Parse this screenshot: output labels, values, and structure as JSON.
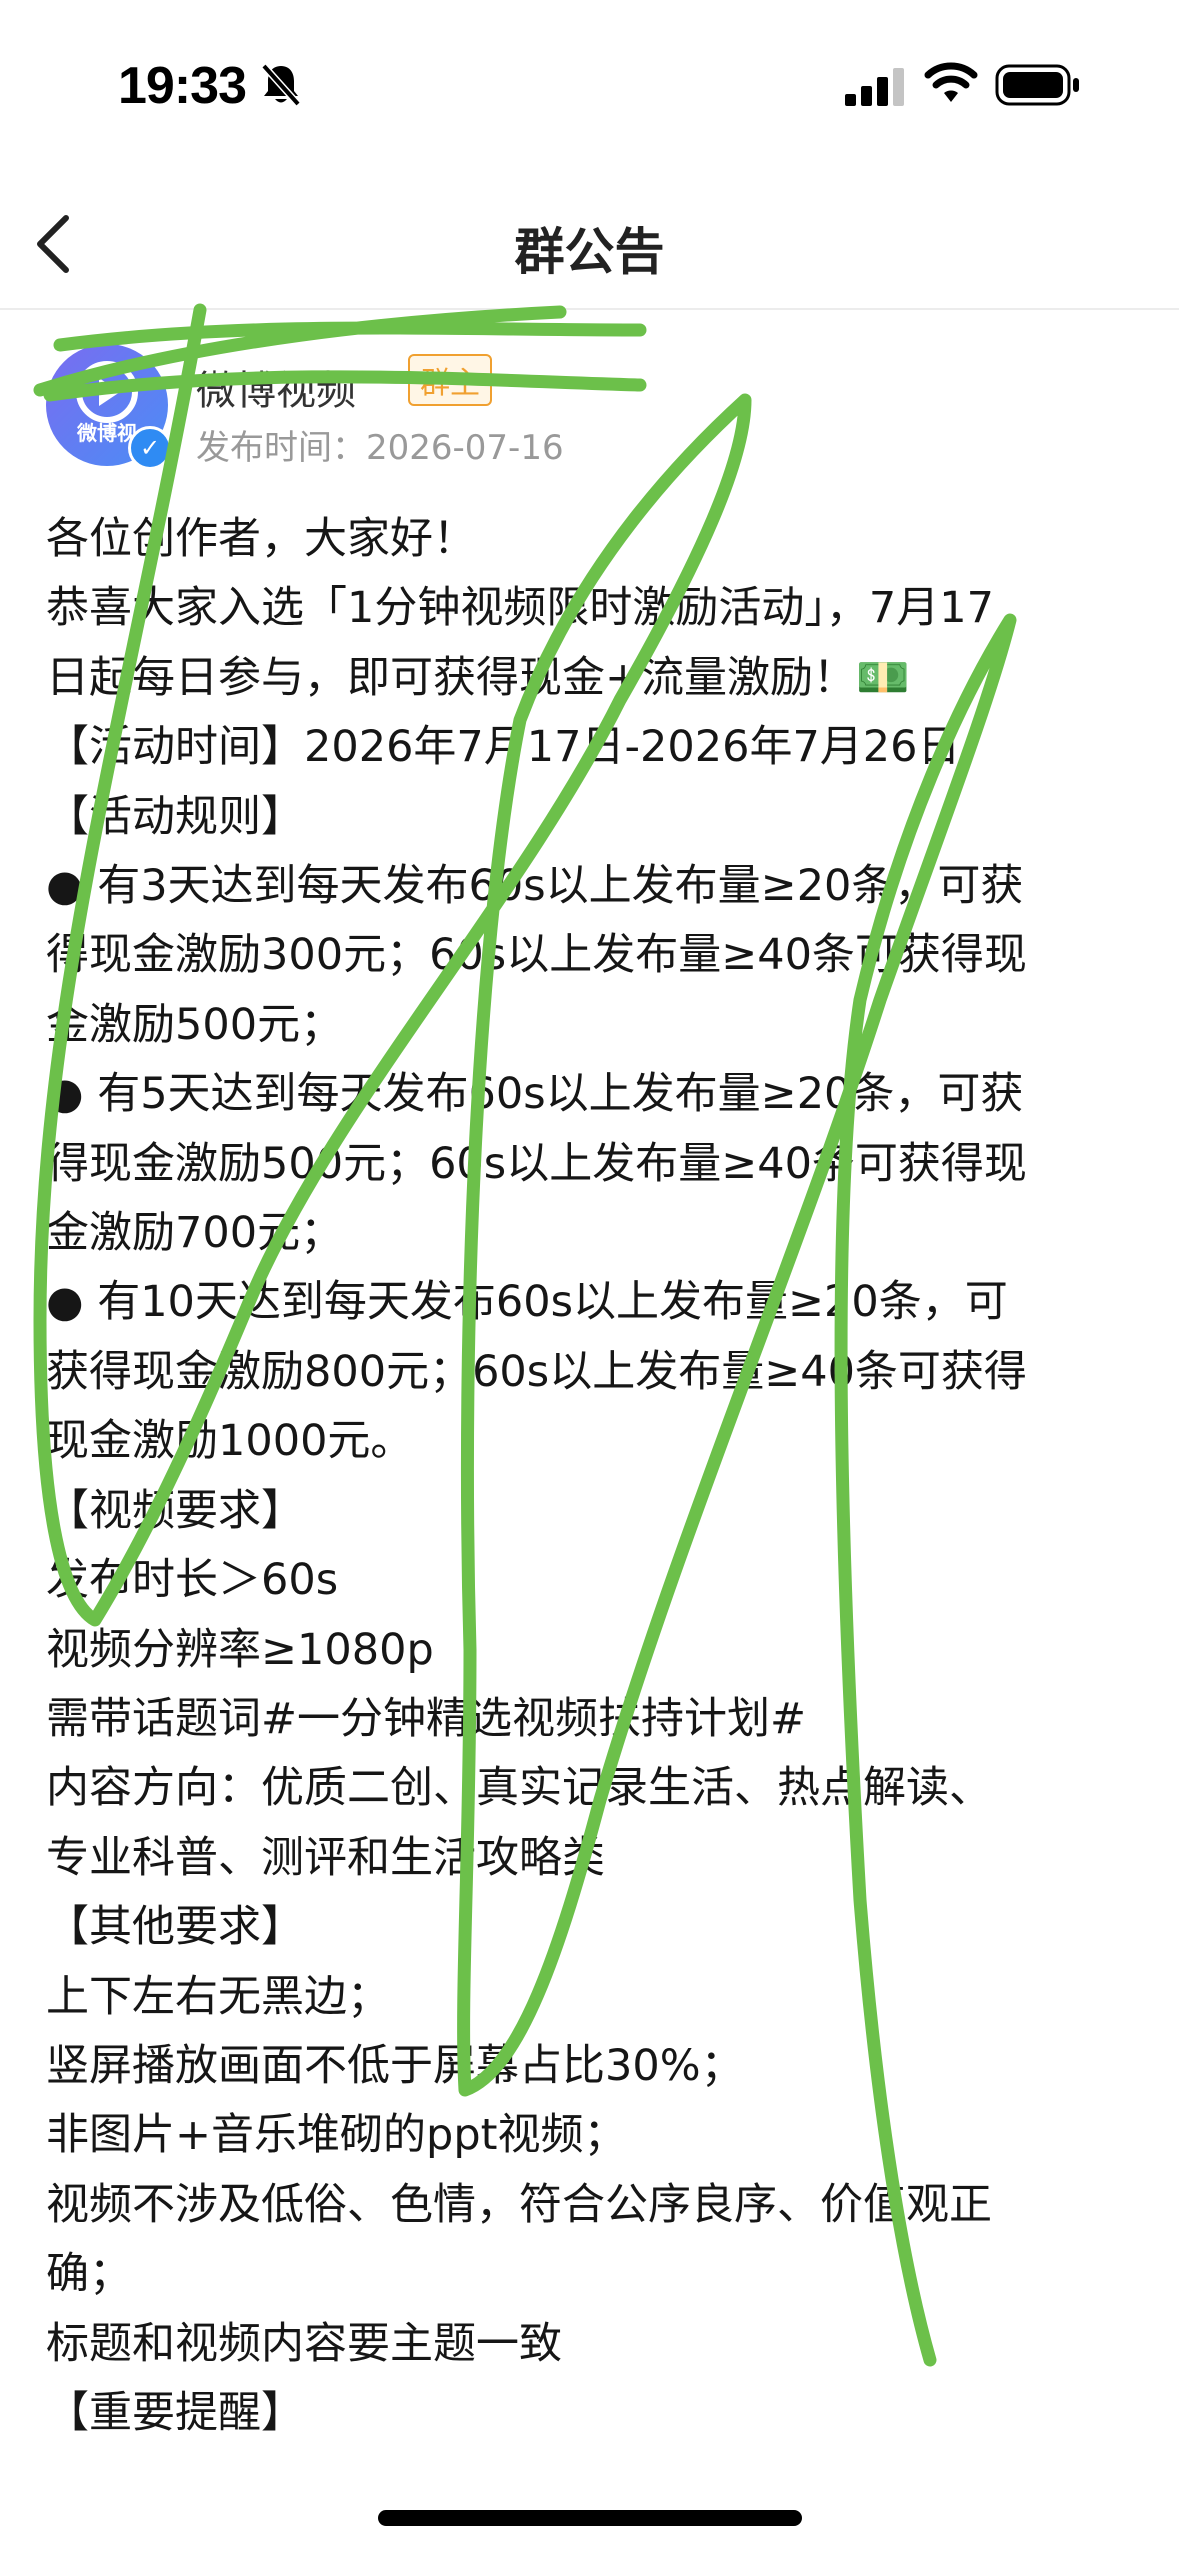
{
  "status_bar": {
    "time": "19:33",
    "icons": [
      "bell-off-icon",
      "signal-icon",
      "wifi-icon",
      "battery-icon"
    ]
  },
  "nav": {
    "back_icon": "chevron-left-icon",
    "title": "群公告"
  },
  "author": {
    "avatar_text": "微博视",
    "name": "微博视频",
    "badge": "群主",
    "publish_time": "发布时间：2026-07-16"
  },
  "announcement": {
    "lines": [
      "各位创作者，大家好！",
      "恭喜大家入选「1分钟视频限时激励活动」，7月17",
      "日起每日参与，即可获得现金+流量激励！💵",
      "【活动时间】2026年7月17日-2026年7月26日",
      "【活动规则】",
      "● 有3天达到每天发布60s以上发布量≥20条，可获",
      "得现金激励300元；60s以上发布量≥40条可获得现",
      "金激励500元；",
      "● 有5天达到每天发布60s以上发布量≥20条，可获",
      "得现金激励500元；60s以上发布量≥40条可获得现",
      "金激励700元；",
      "● 有10天达到每天发布60s以上发布量≥20条，可",
      "获得现金激励800元；60s以上发布量≥40条可获得",
      "现金激励1000元。",
      "【视频要求】",
      "发布时长＞60s",
      "视频分辨率≥1080p",
      "需带话题词#一分钟精选视频扶持计划#",
      "内容方向：优质二创、真实记录生活、热点解读、",
      "专业科普、测评和生活攻略类",
      "【其他要求】",
      "上下左右无黑边；",
      "竖屏播放画面不低于屏幕占比30%；",
      "非图片+音乐堆砌的ppt视频；",
      "视频不涉及低俗、色情，符合公序良序、价值观正",
      "确；",
      "标题和视频内容要主题一致",
      "【重要提醒】"
    ]
  },
  "colors": {
    "scribble": "#6cc04a",
    "owner_badge": "#f0a030",
    "verified": "#2f8bf3"
  }
}
